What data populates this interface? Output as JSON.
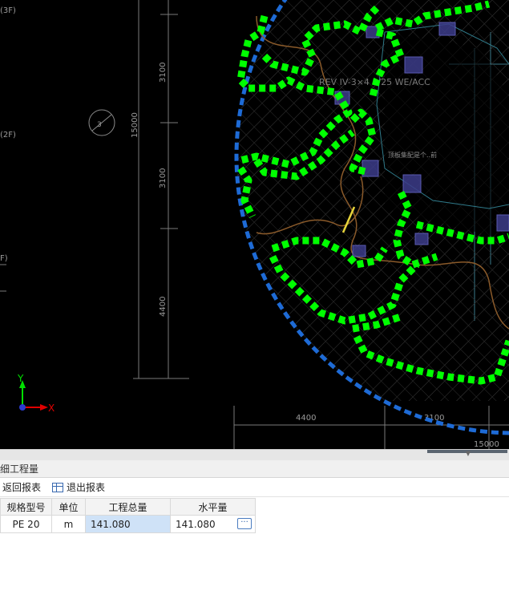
{
  "cad": {
    "background": "#000000",
    "pipe_color": "#00ff00",
    "boundary_color": "#1e6bd6",
    "dimension_labels": {
      "v_3100_top": "3100",
      "v_15000": "15000",
      "v_3100_mid": "3100",
      "v_4400": "4400",
      "h_4400": "4400",
      "h_3100": "3100",
      "h_15000": "15000"
    },
    "floor_labels": {
      "f3": "(3F)",
      "f2": "(2F)",
      "f1": "F)"
    },
    "axis_marker": "3",
    "ribbon_text": "REV IV-3×4 1/25 WE/ACC",
    "small_note": "顶板集配是个..前",
    "ucs": {
      "x_label": "X",
      "y_label": "Y"
    }
  },
  "panel": {
    "title": "细工程量",
    "toolbar": {
      "back_label": "返回报表",
      "exit_label": "退出报表"
    },
    "table": {
      "headers": [
        "规格型号",
        "单位",
        "工程总量",
        "水平量"
      ],
      "rows": [
        {
          "spec": "PE 20",
          "unit": "m",
          "total": "141.080",
          "horizontal": "141.080"
        }
      ],
      "more_button": "···"
    }
  }
}
